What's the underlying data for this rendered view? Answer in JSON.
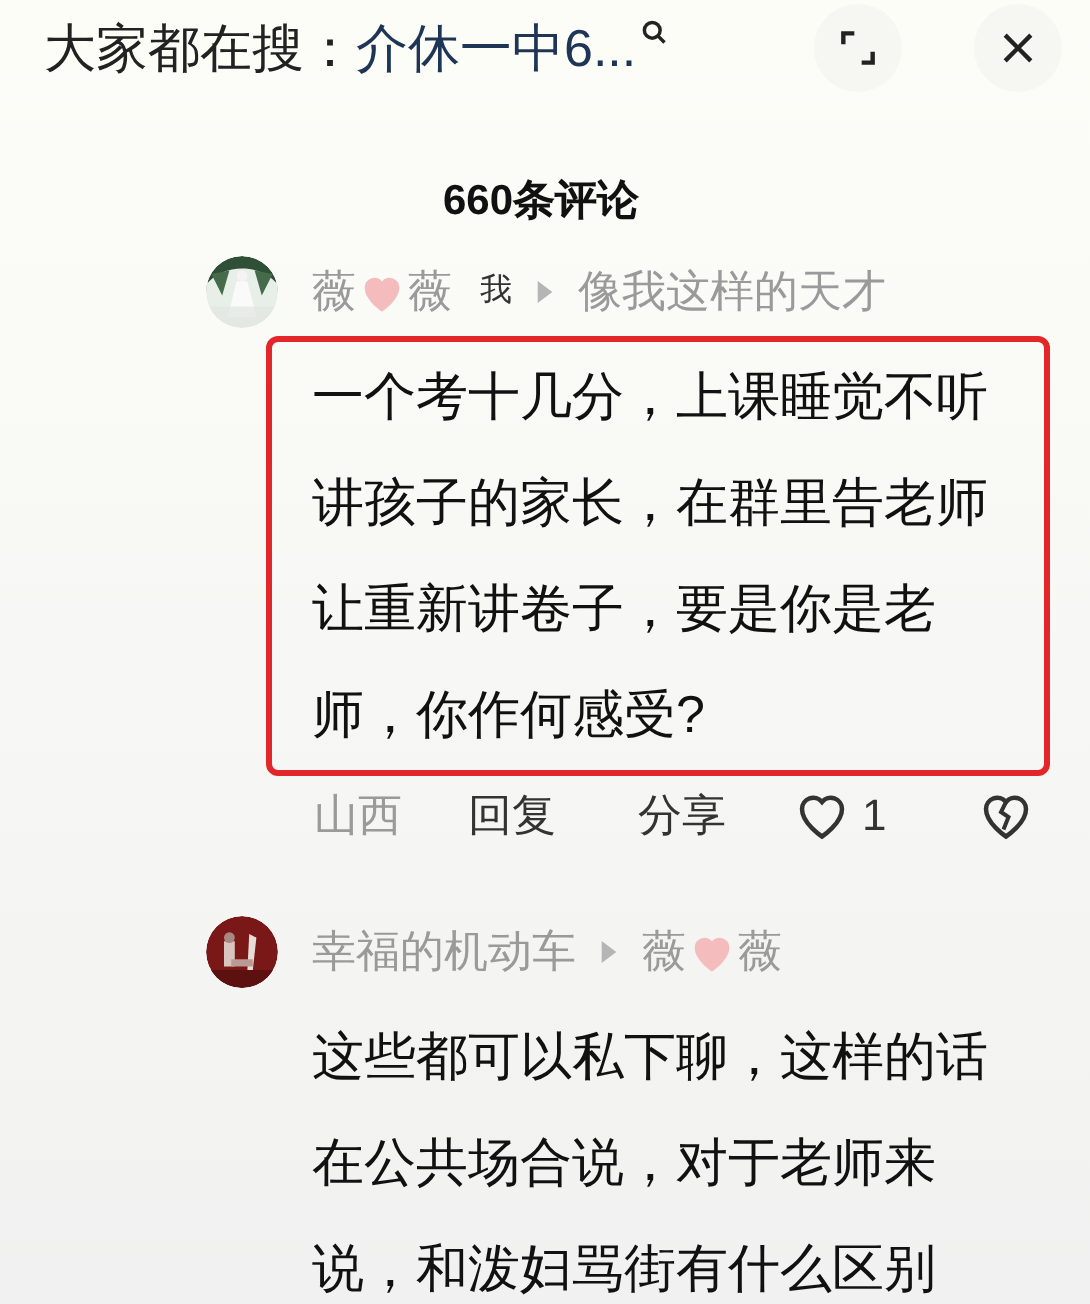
{
  "top_bar": {
    "prefix": "大家都在搜：",
    "query": "介休一中6..."
  },
  "comment_count": "660条评论",
  "comments": [
    {
      "author_parts": [
        "薇",
        "薇"
      ],
      "me_label": "我",
      "reply_to_parts": [
        "像我这样的天才"
      ],
      "text": "一个考十几分，上课睡觉不听讲孩子的家长，在群里告老师让重新讲卷子，要是你是老师，你作何感受?",
      "highlighted": true,
      "location": "山西",
      "reply_label": "回复",
      "share_label": "分享",
      "likes": "1"
    },
    {
      "author_parts": [
        "幸福的机动车"
      ],
      "reply_to_parts": [
        "薇",
        "薇"
      ],
      "text": "这些都可以私下聊，这样的话在公共场合说，对于老师来说，和泼妇骂街有什么区别",
      "highlighted": false
    }
  ]
}
